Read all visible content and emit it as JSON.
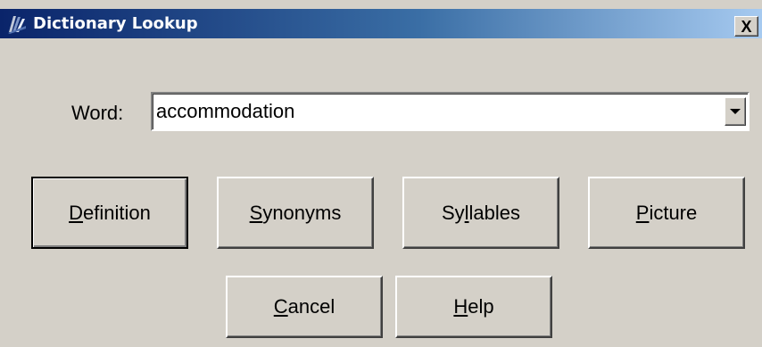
{
  "window": {
    "title": "Dictionary Lookup",
    "close_label": "X",
    "icon": "dictionary-app-icon"
  },
  "word": {
    "label": "Word:",
    "value": "accommodation",
    "dropdown_icon": "chevron-down-icon"
  },
  "buttons": {
    "definition": {
      "pre": "",
      "mnemonic": "D",
      "post": "efinition"
    },
    "synonyms": {
      "pre": "",
      "mnemonic": "S",
      "post": "ynonyms"
    },
    "syllables": {
      "pre": "Sy",
      "mnemonic": "l",
      "post": "lables"
    },
    "picture": {
      "pre": "",
      "mnemonic": "P",
      "post": "icture"
    },
    "cancel": {
      "pre": "",
      "mnemonic": "C",
      "post": "ancel"
    },
    "help": {
      "pre": "",
      "mnemonic": "H",
      "post": "elp"
    }
  },
  "colors": {
    "dialog_bg": "#d4d0c8",
    "title_gradient_start": "#0a246a",
    "title_gradient_end": "#a6caf0",
    "title_text": "#ffffff"
  }
}
